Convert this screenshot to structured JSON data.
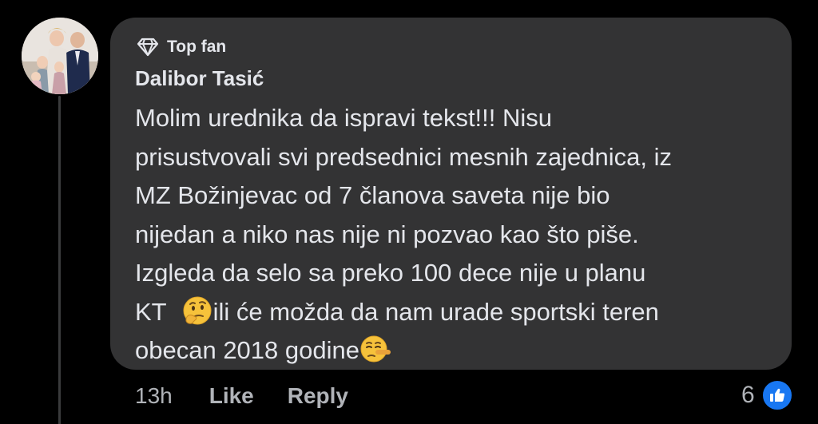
{
  "comment": {
    "badge_icon": "diamond-icon",
    "badge_label": "Top fan",
    "author": "Dalibor Tasić",
    "lines": [
      "Molim urednika da ispravi tekst!!! Nisu",
      "prisustvovali svi predsednici mesnih zajednica, iz",
      "MZ Božinjevac od 7 članova saveta nije bio",
      "nijedan a niko nas nije ni pozvao kao što piše.",
      "Izgleda da selo sa preko 100 dece nije u planu"
    ],
    "line6_start": "KT",
    "line6_end": "ili će možda da nam urade sportski teren",
    "line7": "obecan 2018 godine",
    "emoji_1": "thinking-face-emoji",
    "emoji_2": "lying-face-emoji"
  },
  "actions": {
    "time": "13h",
    "like_label": "Like",
    "reply_label": "Reply"
  },
  "reactions": {
    "count": "6",
    "icon": "thumbs-up-icon"
  },
  "colors": {
    "background": "#000000",
    "bubble": "#333334",
    "text": "#e4e6eb",
    "secondary_text": "#b0b3b8",
    "like_blue": "#1877f2"
  }
}
